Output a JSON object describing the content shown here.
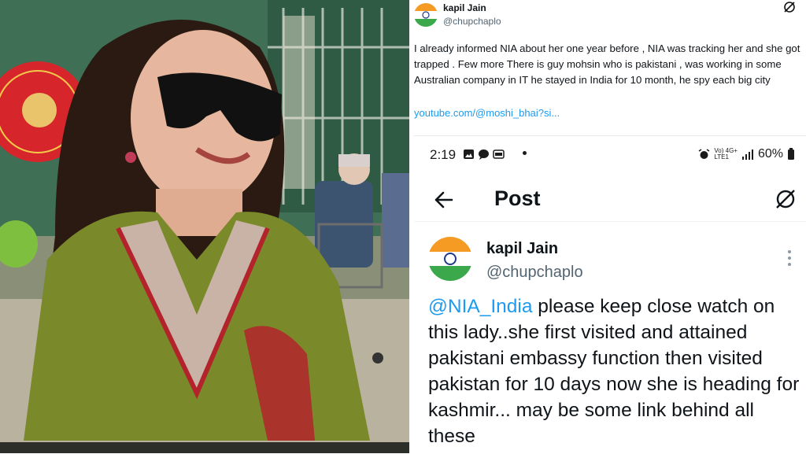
{
  "top_tweet": {
    "name": "kapil Jain",
    "handle": "@chupchaplo",
    "body": "I already informed NIA about her one year before , NIA was tracking her and she got trapped . Few more There is guy mohsin who is pakistani , was working in some Australian company in IT he stayed in India for 10 month,  he spy each big city",
    "link": "youtube.com/@moshi_bhai?si..."
  },
  "status_bar": {
    "time": "2:19",
    "network": "Vo) 4G+",
    "network_sub": "LTE1",
    "battery": "60%"
  },
  "nav": {
    "title": "Post"
  },
  "post": {
    "name": "kapil Jain",
    "handle": "@chupchaplo",
    "mention": "@NIA_India",
    "body": " please keep close watch on this lady..she first visited and attained pakistani embassy function then visited pakistan for 10 days now she is heading for kashmir... may be some link behind all these"
  },
  "colors": {
    "link": "#1d9bf0",
    "text": "#0f1419",
    "muted": "#536471"
  }
}
